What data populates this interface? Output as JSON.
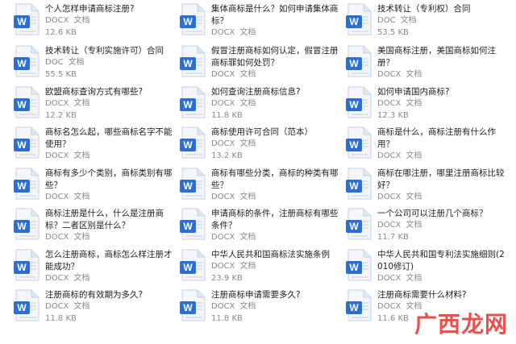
{
  "files": [
    {
      "name": "个人怎样申请商标注册?",
      "type": "DOCX",
      "kind": "文档",
      "size": "12.6 KB",
      "lines": 1
    },
    {
      "name": "集体商标是什么？如何申请集体商标？",
      "type": "DOCX",
      "kind": "文档",
      "size": "",
      "lines": 2
    },
    {
      "name": "技术转让（专利权）合同",
      "type": "DOC",
      "kind": "文档",
      "size": "53.5 KB",
      "lines": 1
    },
    {
      "name": "技术转让（专利实施许可）合同",
      "type": "DOC",
      "kind": "文档",
      "size": "55.5 KB",
      "lines": 1
    },
    {
      "name": "假冒注册商标如何认定，假冒注册商标罪如何处罚？",
      "type": "DOCX",
      "kind": "文档",
      "size": "",
      "lines": 2
    },
    {
      "name": "美国商标注册，美国商标如何注册？",
      "type": "DOCX",
      "kind": "文档",
      "size": "",
      "lines": 2
    },
    {
      "name": "欧盟商标查询方式有哪些?",
      "type": "DOCX",
      "kind": "文档",
      "size": "12.2 KB",
      "lines": 1
    },
    {
      "name": "如何查询注册商标信息?",
      "type": "DOCX",
      "kind": "文档",
      "size": "11.8 KB",
      "lines": 1
    },
    {
      "name": "如何申请国内商标?",
      "type": "DOCX",
      "kind": "文档",
      "size": "12.3 KB",
      "lines": 1
    },
    {
      "name": "商标名怎么起，哪些商标名字不能使用？",
      "type": "DOCX",
      "kind": "文档",
      "size": "",
      "lines": 2
    },
    {
      "name": "商标使用许可合同（范本）",
      "type": "DOCX",
      "kind": "文档",
      "size": "13.2 KB",
      "lines": 1
    },
    {
      "name": "商标是什么，商标注册有什么作用？",
      "type": "DOCX",
      "kind": "文档",
      "size": "",
      "lines": 2
    },
    {
      "name": "商标有多少个类别，商标类别有哪些？",
      "type": "DOCX",
      "kind": "文档",
      "size": "",
      "lines": 2
    },
    {
      "name": "商标有哪些分类，商标的种类有哪些？",
      "type": "DOCX",
      "kind": "文档",
      "size": "",
      "lines": 2
    },
    {
      "name": "商标在哪注册，哪里注册商标比较好？",
      "type": "DOCX",
      "kind": "文档",
      "size": "",
      "lines": 2
    },
    {
      "name": "商标注册是什么，什么是注册商标？二者区别是什么？",
      "type": "DOCX",
      "kind": "文档",
      "size": "",
      "lines": 2
    },
    {
      "name": "申请商标的条件，注册商标有哪些条件？",
      "type": "DOCX",
      "kind": "文档",
      "size": "",
      "lines": 2
    },
    {
      "name": "一个公司可以注册几个商标？",
      "type": "DOCX",
      "kind": "文档",
      "size": "11.7 KB",
      "lines": 1
    },
    {
      "name": "怎么注册商标，商标怎么样注册才能成功？",
      "type": "DOCX",
      "kind": "文档",
      "size": "",
      "lines": 2
    },
    {
      "name": "中华人民共和国商标法实施条例",
      "type": "DOCX",
      "kind": "文档",
      "size": "23.9 KB",
      "lines": 1
    },
    {
      "name": "中华人民共和国专利法实施细则(2010修订)",
      "type": "DOCX",
      "kind": "文档",
      "size": "",
      "lines": 2
    },
    {
      "name": "注册商标的有效期为多久?",
      "type": "DOCX",
      "kind": "文档",
      "size": "11.8 KB",
      "lines": 1
    },
    {
      "name": "注册商标申请需要多久?",
      "type": "DOCX",
      "kind": "文档",
      "size": "11.8 KB",
      "lines": 1
    },
    {
      "name": "注册商标需要什么材料?",
      "type": "DOCX",
      "kind": "文档",
      "size": "11.6 KB",
      "lines": 1
    }
  ],
  "watermark": "广西龙网",
  "colors": {
    "icon_blue": "#2b6fd6",
    "watermark_red": "#e9312c"
  }
}
